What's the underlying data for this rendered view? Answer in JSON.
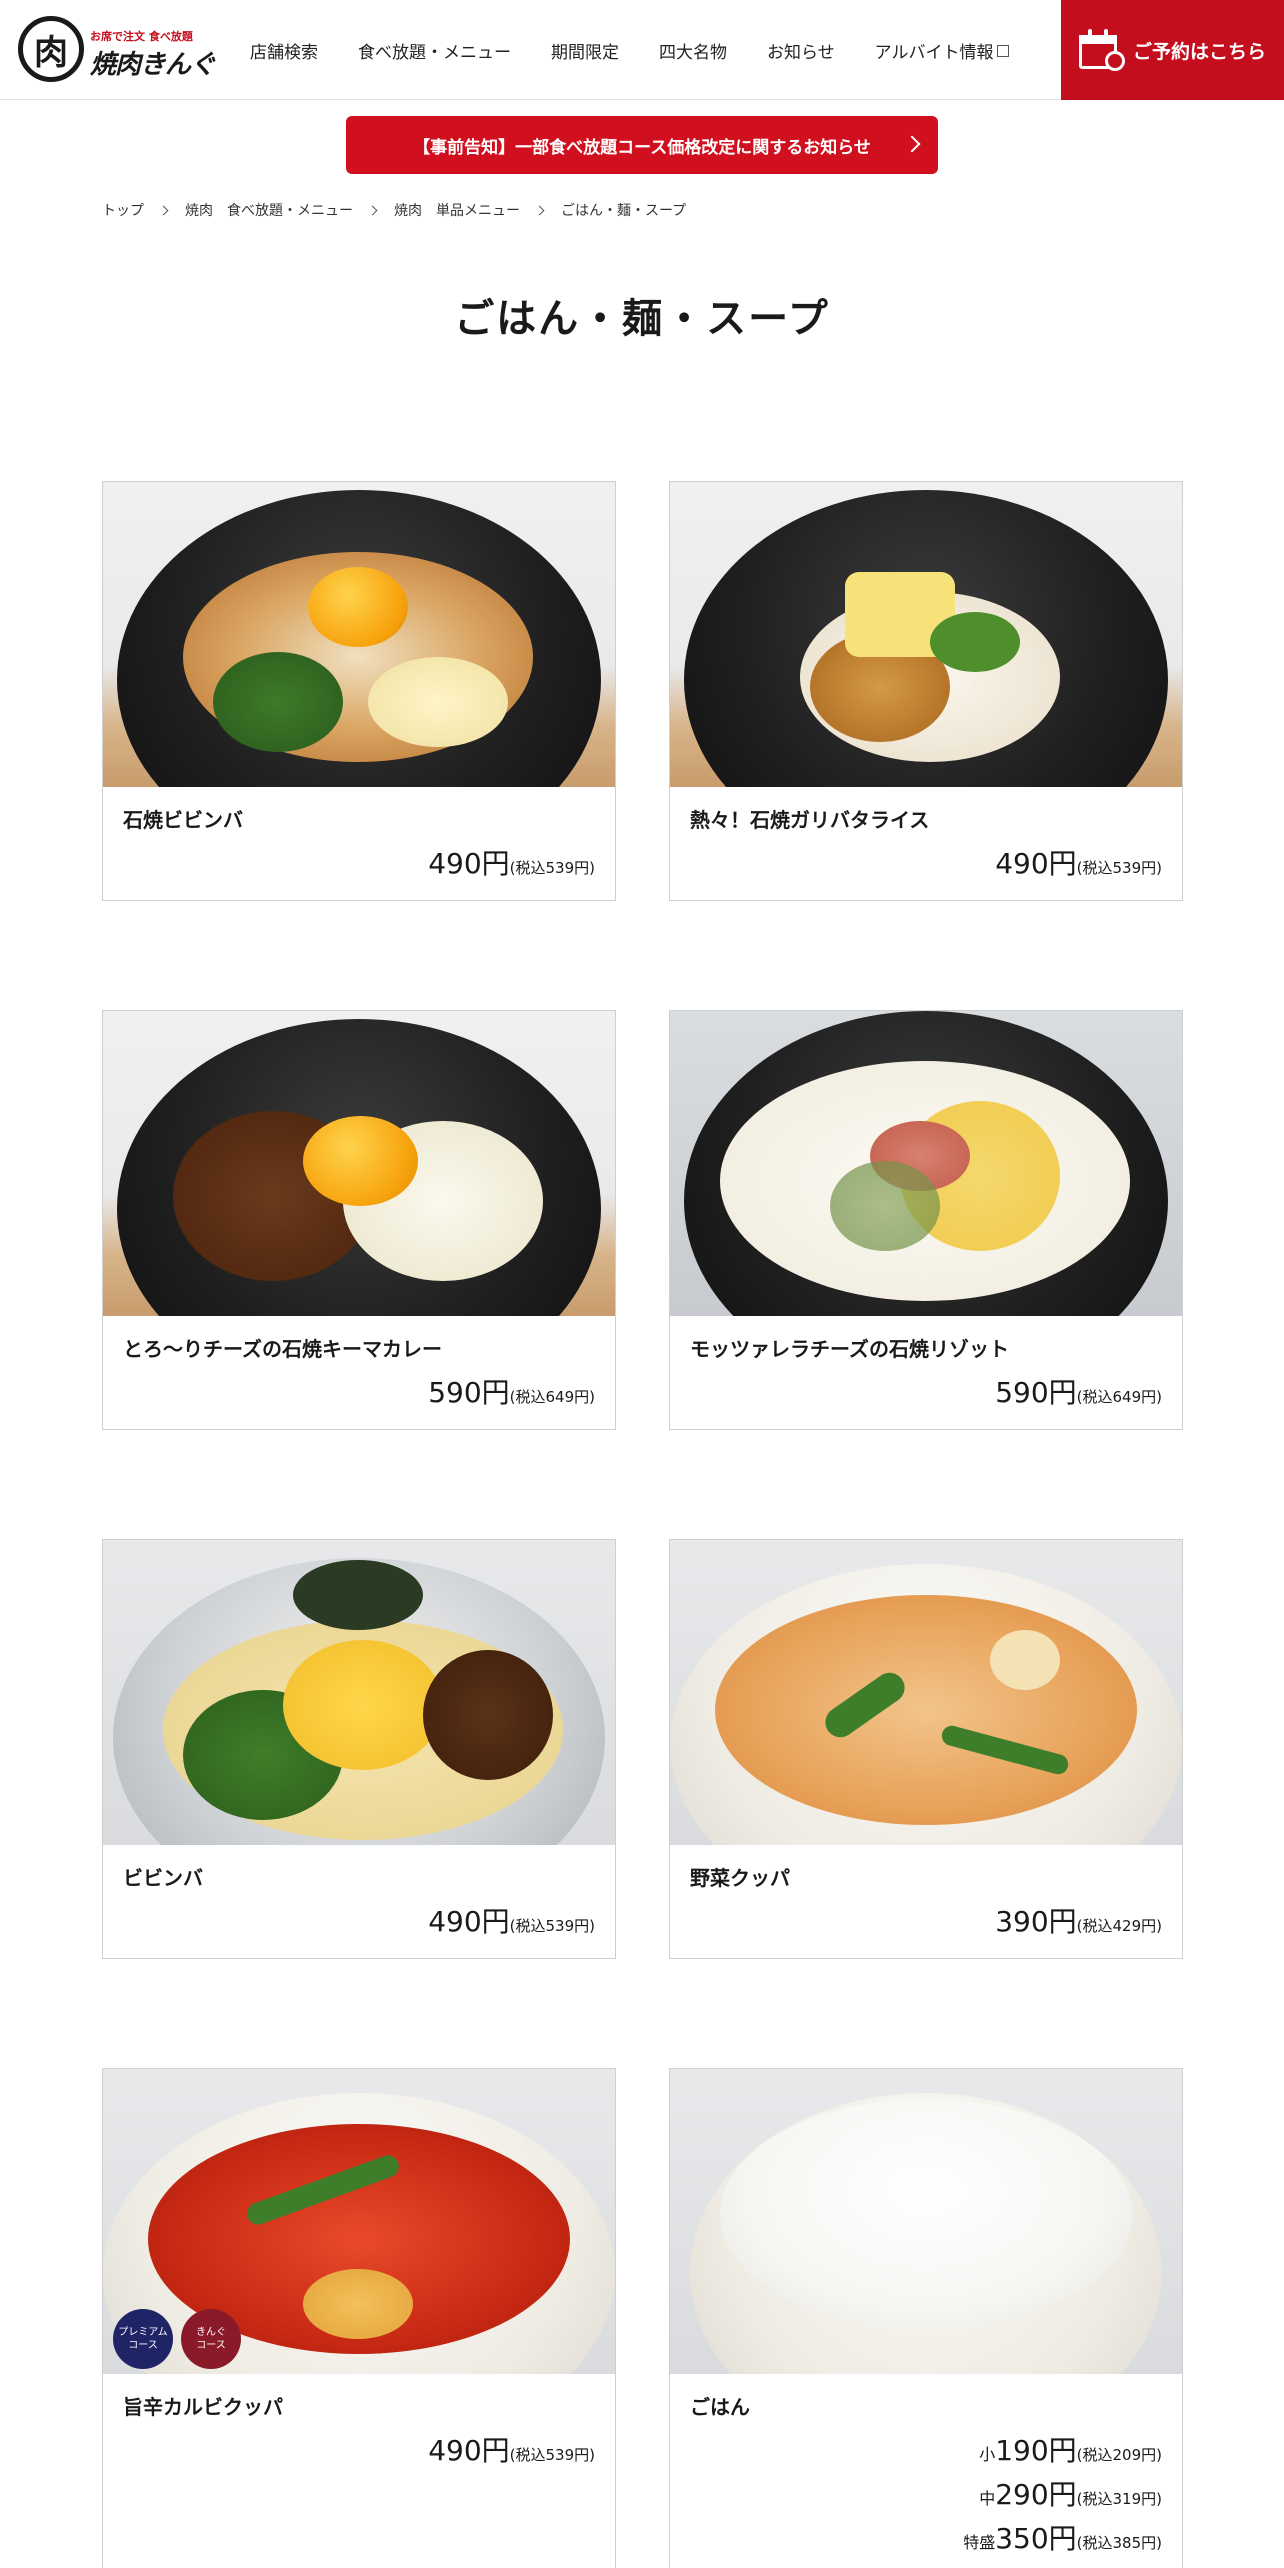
{
  "header": {
    "logo_text": "焼肉きんぐ",
    "logo_seal": "肉",
    "logo_tagline": "お席で注文 食べ放題",
    "nav": [
      {
        "label": "店舗検索"
      },
      {
        "label": "食べ放題・メニュー"
      },
      {
        "label": "期間限定"
      },
      {
        "label": "四大名物"
      },
      {
        "label": "お知らせ"
      },
      {
        "label": "アルバイト情報"
      }
    ],
    "reserve_label": "ご予約はこちら"
  },
  "notice": {
    "label": "【事前告知】一部食べ放題コース価格改定に関するお知らせ"
  },
  "breadcrumb": [
    "トップ",
    "焼肉　食べ放題・メニュー",
    "焼肉　単品メニュー",
    "ごはん・麺・スープ"
  ],
  "page_title": "ごはん・麺・スープ",
  "menu": [
    {
      "name": "石焼ビビンバ",
      "prices": [
        {
          "size": "",
          "price": "490円",
          "tax": "(税込539円)"
        }
      ]
    },
    {
      "name": "熱々！石焼ガリバタライス",
      "prices": [
        {
          "size": "",
          "price": "490円",
          "tax": "(税込539円)"
        }
      ]
    },
    {
      "name": "とろ〜りチーズの石焼キーマカレー",
      "prices": [
        {
          "size": "",
          "price": "590円",
          "tax": "(税込649円)"
        }
      ]
    },
    {
      "name": "モッツァレラチーズの石焼リゾット",
      "prices": [
        {
          "size": "",
          "price": "590円",
          "tax": "(税込649円)"
        }
      ]
    },
    {
      "name": "ビビンバ",
      "prices": [
        {
          "size": "",
          "price": "490円",
          "tax": "(税込539円)"
        }
      ]
    },
    {
      "name": "野菜クッパ",
      "prices": [
        {
          "size": "",
          "price": "390円",
          "tax": "(税込429円)"
        }
      ]
    },
    {
      "name": "旨辛カルビクッパ",
      "prices": [
        {
          "size": "",
          "price": "490円",
          "tax": "(税込539円)"
        }
      ],
      "badges": [
        {
          "label": "プレミアム\nコース",
          "color": "#1e2466"
        },
        {
          "label": "きんぐ\nコース",
          "color": "#8a1a2a"
        }
      ]
    },
    {
      "name": "ごはん",
      "prices": [
        {
          "size": "小",
          "price": "190円",
          "tax": "(税込209円)"
        },
        {
          "size": "中",
          "price": "290円",
          "tax": "(税込319円)"
        },
        {
          "size": "特盛",
          "price": "350円",
          "tax": "(税込385円)"
        }
      ]
    }
  ],
  "colors": {
    "brand_red": "#c40e1e",
    "notice_red": "#d0101e",
    "text": "#1a1a1a"
  }
}
